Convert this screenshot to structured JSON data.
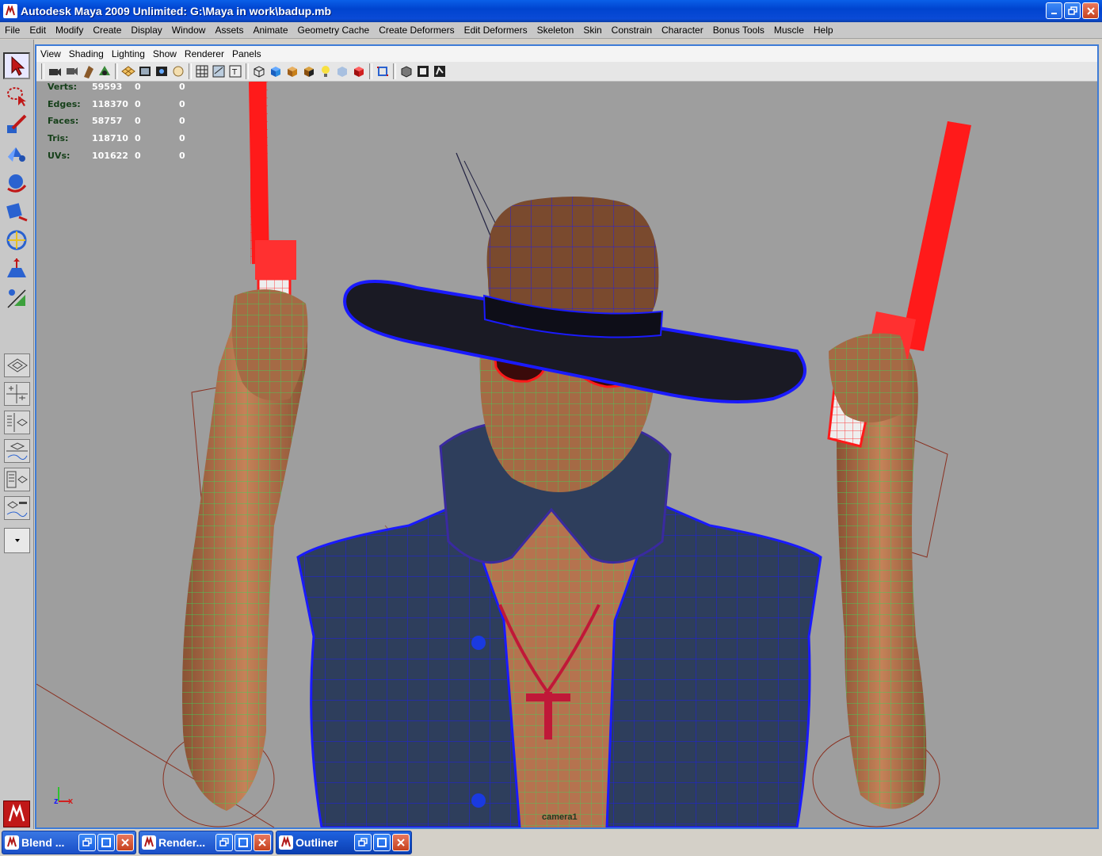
{
  "window": {
    "title": "Autodesk Maya 2009 Unlimited: G:\\Maya in work\\badup.mb",
    "controls": [
      "minimize",
      "restore",
      "close"
    ]
  },
  "menubar": [
    "File",
    "Edit",
    "Modify",
    "Create",
    "Display",
    "Window",
    "Assets",
    "Animate",
    "Geometry Cache",
    "Create Deformers",
    "Edit Deformers",
    "Skeleton",
    "Skin",
    "Constrain",
    "Character",
    "Bonus Tools",
    "Muscle",
    "Help"
  ],
  "panel": {
    "menu": [
      "View",
      "Shading",
      "Lighting",
      "Show",
      "Renderer",
      "Panels"
    ],
    "camera": "camera1",
    "axis": {
      "x": "x",
      "z": "z"
    }
  },
  "hud": [
    {
      "label": "Verts:",
      "value": "59593",
      "sel": "0",
      "comp": "0"
    },
    {
      "label": "Edges:",
      "value": "118370",
      "sel": "0",
      "comp": "0"
    },
    {
      "label": "Faces:",
      "value": "58757",
      "sel": "0",
      "comp": "0"
    },
    {
      "label": "Tris:",
      "value": "118710",
      "sel": "0",
      "comp": "0"
    },
    {
      "label": "UVs:",
      "value": "101622",
      "sel": "0",
      "comp": "0"
    }
  ],
  "taskbar": [
    {
      "name": "Blend ...",
      "active": false
    },
    {
      "name": "Render...",
      "active": false
    },
    {
      "name": "Outliner",
      "active": true
    }
  ],
  "colors": {
    "viewport_bg": "#9e9e9e",
    "wire_green": "#3fd25a",
    "wire_blue": "#1a1aff",
    "wire_red": "#ff1a1a",
    "skin": "#b5734f",
    "denim": "#2e3e5c",
    "hat": "#7a4a2e"
  }
}
